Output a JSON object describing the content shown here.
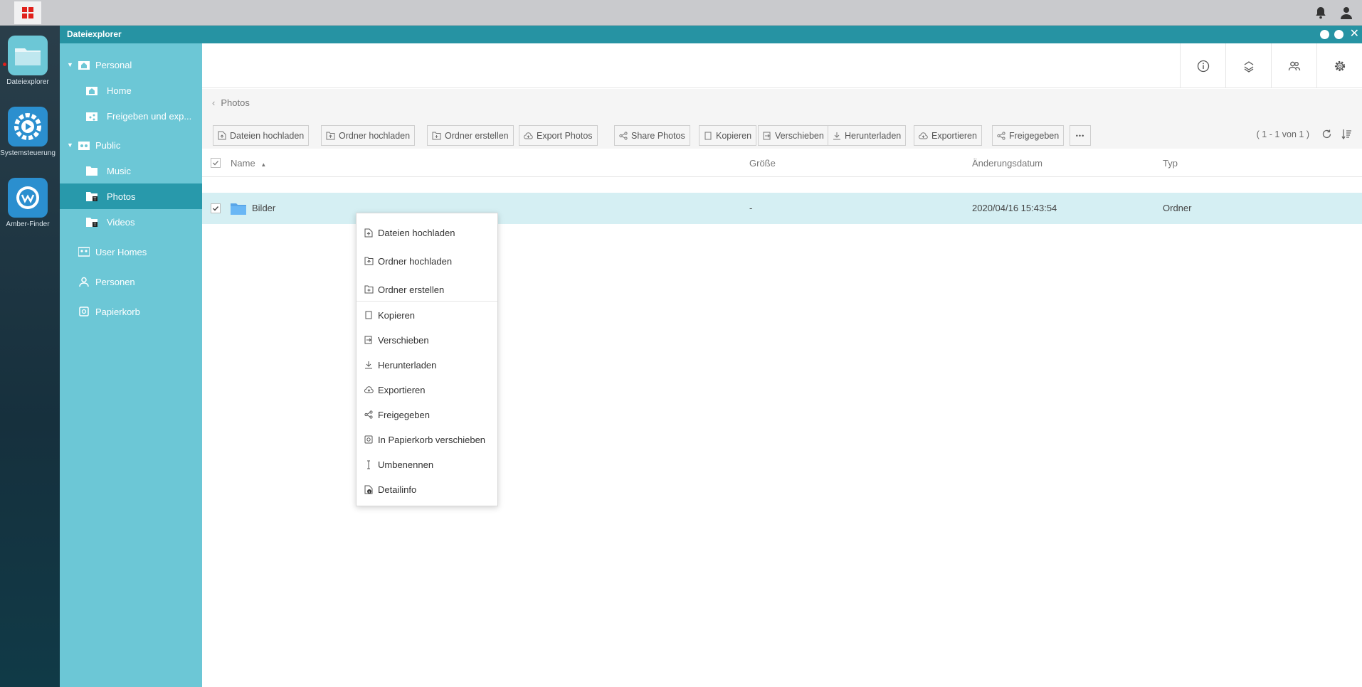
{
  "dock": {
    "apps": [
      {
        "label": "Dateiexplorer"
      },
      {
        "label": "Systemsteuerung"
      },
      {
        "label": "Amber-Finder"
      }
    ]
  },
  "window": {
    "title": "Dateiexplorer"
  },
  "sidebar": {
    "items": [
      {
        "label": "Personal"
      },
      {
        "label": "Home"
      },
      {
        "label": "Freigeben und exp..."
      },
      {
        "label": "Public"
      },
      {
        "label": "Music"
      },
      {
        "label": "Photos"
      },
      {
        "label": "Videos"
      },
      {
        "label": "User Homes"
      },
      {
        "label": "Personen"
      },
      {
        "label": "Papierkorb"
      }
    ],
    "selected": "Photos",
    "accent": "#6cc7d6",
    "selected_color": "#2899ab"
  },
  "breadcrumb": {
    "current": "Photos"
  },
  "toolbar": {
    "buttons": [
      "Dateien hochladen",
      "Ordner hochladen",
      "Ordner erstellen",
      "Export Photos",
      "Share Photos",
      "Kopieren",
      "Verschieben",
      "Herunterladen",
      "Exportieren",
      "Freigegeben"
    ],
    "more_label": "•••",
    "pager": "( 1 - 1 von 1 )"
  },
  "table": {
    "columns": {
      "name": "Name",
      "size": "Größe",
      "modified": "Änderungsdatum",
      "type": "Typ"
    },
    "rows": [
      {
        "name": "Bilder",
        "size": "-",
        "modified": "2020/04/16 15:43:54",
        "type": "Ordner",
        "checked": true
      }
    ]
  },
  "context_menu": {
    "items": [
      "Dateien hochladen",
      "Ordner hochladen",
      "Ordner erstellen",
      "Kopieren",
      "Verschieben",
      "Herunterladen",
      "Exportieren",
      "Freigegeben",
      "In Papierkorb verschieben",
      "Umbenennen",
      "Detailinfo"
    ]
  }
}
